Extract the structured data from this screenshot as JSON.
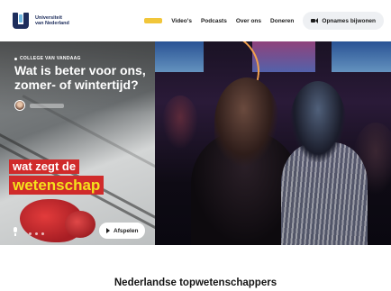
{
  "header": {
    "logo_line1": "Universiteit",
    "logo_line2": "van Nederland",
    "nav": [
      {
        "label": "Video's"
      },
      {
        "label": "Podcasts"
      },
      {
        "label": "Over ons"
      },
      {
        "label": "Doneren"
      }
    ],
    "cta_label": "Opnames bijwonen",
    "cta_icon": "video-camera-icon"
  },
  "hero": {
    "eyebrow": "COLLEGE VAN VANDAAG",
    "title": "Wat is beter voor ons, zomer- of wintertijd?",
    "tag_line1": "wat zegt de",
    "tag_line2": "wetenschap",
    "play_label": "Afspelen",
    "play_icon": "play-icon",
    "podcast_icon": "microphone-icon"
  },
  "section": {
    "title": "Nederlandse topwetenschappers"
  },
  "colors": {
    "brand_navy": "#1d2d5c",
    "accent_yellow": "#f1c63a",
    "tag_red": "#d02b2b",
    "tag_yellow": "#f4e01c"
  }
}
